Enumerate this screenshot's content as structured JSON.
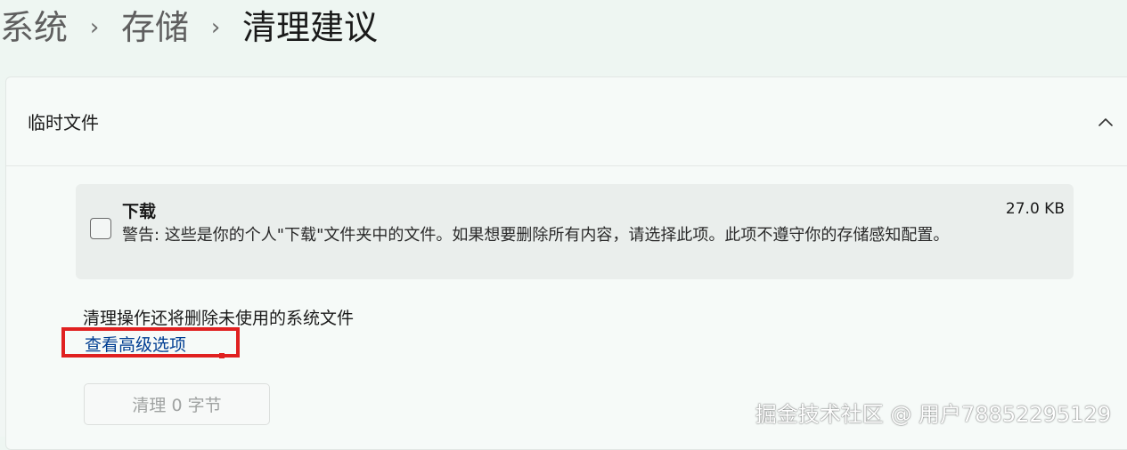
{
  "breadcrumb": {
    "items": [
      "系统",
      "存储",
      "清理建议"
    ],
    "separator": "›"
  },
  "section": {
    "title": "临时文件",
    "expanded": true,
    "collapse_icon": "chevron-up-icon"
  },
  "item": {
    "title": "下载",
    "size": "27.0 KB",
    "checked": false,
    "description": "警告: 这些是你的个人\"下载\"文件夹中的文件。如果想要删除所有内容，请选择此项。此项不遵守你的存储感知配置。"
  },
  "footer": {
    "note": "清理操作还将删除未使用的系统文件",
    "advanced_link": "查看高级选项",
    "clean_button": "清理 0 字节",
    "clean_button_enabled": false
  },
  "watermark": "掘金技术社区 @ 用户78852295129",
  "colors": {
    "link": "#003e92",
    "highlight": "#e02020",
    "disabled_text": "#a0a3a2"
  }
}
